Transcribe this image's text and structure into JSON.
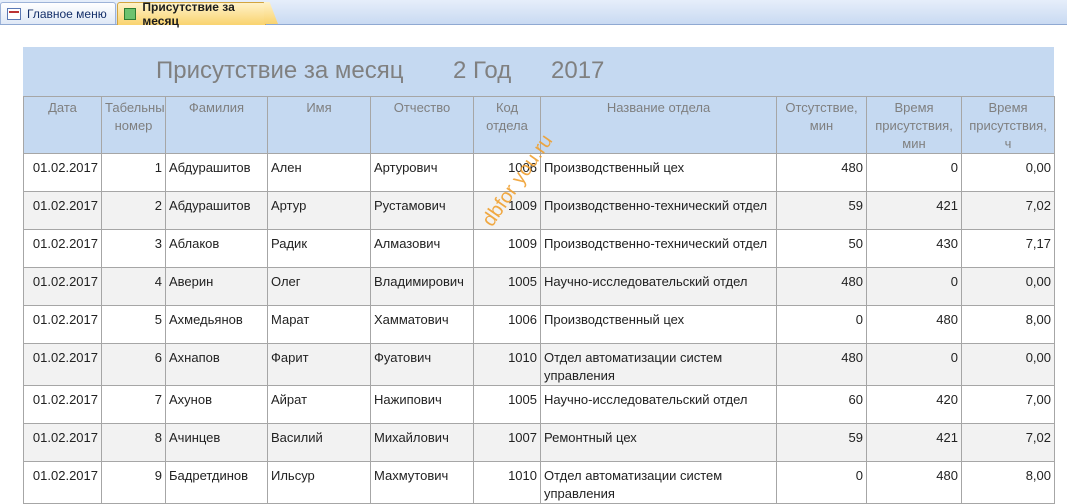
{
  "tabs": [
    {
      "label": "Главное меню",
      "icon": "form-icon"
    },
    {
      "label": "Присутствие за месяц",
      "icon": "report-icon"
    }
  ],
  "report": {
    "title": "Присутствие за месяц",
    "period": "2 Год",
    "year": "2017"
  },
  "columns": [
    "Дата",
    "Табельный номер",
    "Фамилия",
    "Имя",
    "Отчество",
    "Код отдела",
    "Название отдела",
    "Отсутствие, мин",
    "Время присутствия, мин",
    "Время присутствия, ч"
  ],
  "rows": [
    {
      "date": "01.02.2017",
      "tab": "1",
      "last": "Абдурашитов",
      "first": "Ален",
      "middle": "Артурович",
      "code": "1006",
      "dept": "Производственный цех",
      "absent": "480",
      "present_min": "0",
      "present_h": "0,00"
    },
    {
      "date": "01.02.2017",
      "tab": "2",
      "last": "Абдурашитов",
      "first": "Артур",
      "middle": "Рустамович",
      "code": "1009",
      "dept": "Производственно-технический отдел",
      "absent": "59",
      "present_min": "421",
      "present_h": "7,02"
    },
    {
      "date": "01.02.2017",
      "tab": "3",
      "last": "Аблаков",
      "first": "Радик",
      "middle": "Алмазович",
      "code": "1009",
      "dept": "Производственно-технический отдел",
      "absent": "50",
      "present_min": "430",
      "present_h": "7,17"
    },
    {
      "date": "01.02.2017",
      "tab": "4",
      "last": "Аверин",
      "first": "Олег",
      "middle": "Владимирович",
      "code": "1005",
      "dept": "Научно-исследовательский отдел",
      "absent": "480",
      "present_min": "0",
      "present_h": "0,00"
    },
    {
      "date": "01.02.2017",
      "tab": "5",
      "last": "Ахмедьянов",
      "first": "Марат",
      "middle": "Хамматович",
      "code": "1006",
      "dept": "Производственный цех",
      "absent": "0",
      "present_min": "480",
      "present_h": "8,00"
    },
    {
      "date": "01.02.2017",
      "tab": "6",
      "last": "Ахнапов",
      "first": "Фарит",
      "middle": "Фуатович",
      "code": "1010",
      "dept": "Отдел автоматизации систем управления",
      "absent": "480",
      "present_min": "0",
      "present_h": "0,00"
    },
    {
      "date": "01.02.2017",
      "tab": "7",
      "last": "Ахунов",
      "first": "Айрат",
      "middle": "Нажипович",
      "code": "1005",
      "dept": "Научно-исследовательский отдел",
      "absent": "60",
      "present_min": "420",
      "present_h": "7,00"
    },
    {
      "date": "01.02.2017",
      "tab": "8",
      "last": "Ачинцев",
      "first": "Василий",
      "middle": "Михайлович",
      "code": "1007",
      "dept": "Ремонтный цех",
      "absent": "59",
      "present_min": "421",
      "present_h": "7,02"
    },
    {
      "date": "01.02.2017",
      "tab": "9",
      "last": "Бадретдинов",
      "first": "Ильсур",
      "middle": "Махмутович",
      "code": "1010",
      "dept": "Отдел автоматизации систем управления",
      "absent": "0",
      "present_min": "480",
      "present_h": "8,00"
    }
  ],
  "watermark": "dbfor you.ru"
}
